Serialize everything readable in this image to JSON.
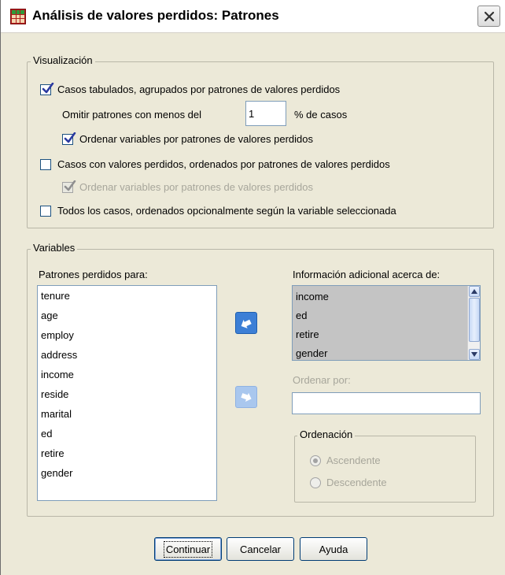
{
  "window": {
    "title": "Análisis de valores perdidos: Patrones",
    "icon": "table-grid-icon",
    "close_icon": "close-icon"
  },
  "visualizacion": {
    "legend": "Visualización",
    "tabulated": {
      "label": "Casos tabulados, agrupados por patrones de valores perdidos",
      "checked": true
    },
    "omit_prefix": "Omitir patrones con menos del",
    "omit_value": "1",
    "omit_suffix": "% de casos",
    "sort_vars_1": {
      "label": "Ordenar variables por patrones de valores perdidos",
      "checked": true
    },
    "cases_missing": {
      "label": "Casos con valores perdidos, ordenados por patrones de valores perdidos",
      "checked": false
    },
    "sort_vars_2": {
      "label": "Ordenar variables por patrones de valores perdidos",
      "checked": true,
      "disabled": true
    },
    "all_cases": {
      "label": "Todos los casos, ordenados opcionalmente según la variable seleccionada",
      "checked": false
    }
  },
  "variables": {
    "legend": "Variables",
    "missing_patterns_label": "Patrones perdidos para:",
    "missing_patterns_items": [
      "tenure",
      "age",
      "employ",
      "address",
      "income",
      "reside",
      "marital",
      "ed",
      "retire",
      "gender"
    ],
    "additional_info_label": "Información adicional acerca de:",
    "additional_info_items": [
      "income",
      "ed",
      "retire",
      "gender"
    ],
    "sort_by_label": "Ordenar por:",
    "sort_by_value": "",
    "ordenacion": {
      "legend": "Ordenación",
      "ascending": "Ascendente",
      "descending": "Descendente",
      "selected": "Ascendente"
    }
  },
  "buttons": {
    "continue": "Continuar",
    "cancel": "Cancelar",
    "help": "Ayuda"
  },
  "colors": {
    "dialog_bg": "#ece9d8",
    "accent_arrow": "#3c7fd6",
    "check_green": "#2b7d1e"
  }
}
